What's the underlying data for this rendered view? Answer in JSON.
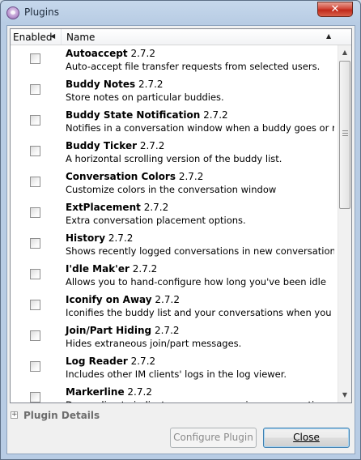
{
  "window": {
    "title": "Plugins",
    "close_glyph": "✕"
  },
  "columns": {
    "enabled": "Enabled",
    "name": "Name"
  },
  "plugins": [
    {
      "name": "Autoaccept",
      "version": "2.7.2",
      "description": "Auto-accept file transfer requests from selected users.",
      "enabled": false
    },
    {
      "name": "Buddy Notes",
      "version": "2.7.2",
      "description": "Store notes on particular buddies.",
      "enabled": false
    },
    {
      "name": "Buddy State Notification",
      "version": "2.7.2",
      "description": "Notifies in a conversation window when a buddy goes or retu...",
      "enabled": false
    },
    {
      "name": "Buddy Ticker",
      "version": "2.7.2",
      "description": "A horizontal scrolling version of the buddy list.",
      "enabled": false
    },
    {
      "name": "Conversation Colors",
      "version": "2.7.2",
      "description": "Customize colors in the conversation window",
      "enabled": false
    },
    {
      "name": "ExtPlacement",
      "version": "2.7.2",
      "description": "Extra conversation placement options.",
      "enabled": false
    },
    {
      "name": "History",
      "version": "2.7.2",
      "description": "Shows recently logged conversations in new conversations.",
      "enabled": false
    },
    {
      "name": "I'dle Mak'er",
      "version": "2.7.2",
      "description": "Allows you to hand-configure how long you've been idle",
      "enabled": false
    },
    {
      "name": "Iconify on Away",
      "version": "2.7.2",
      "description": "Iconifies the buddy list and your conversations when you go ...",
      "enabled": false
    },
    {
      "name": "Join/Part Hiding",
      "version": "2.7.2",
      "description": "Hides extraneous join/part messages.",
      "enabled": false
    },
    {
      "name": "Log Reader",
      "version": "2.7.2",
      "description": "Includes other IM clients' logs in the log viewer.",
      "enabled": false
    },
    {
      "name": "Markerline",
      "version": "2.7.2",
      "description": "Draw a line to indicate new messages in a conversation",
      "enabled": false
    }
  ],
  "details": {
    "label": "Plugin Details",
    "expander": "+"
  },
  "buttons": {
    "configure": "Configure Plugin",
    "close": "Close"
  }
}
